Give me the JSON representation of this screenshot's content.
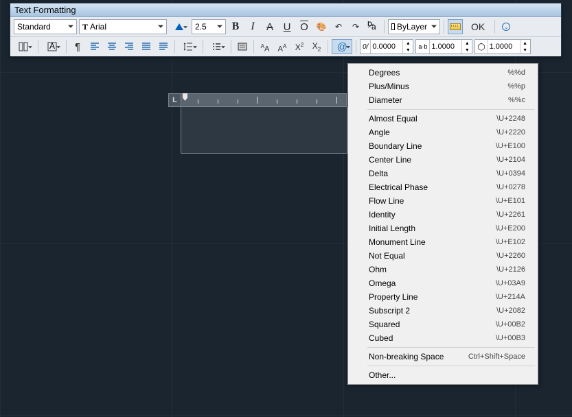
{
  "panel": {
    "title": "Text Formatting"
  },
  "row1": {
    "style": "Standard",
    "font": "Arial",
    "size": "2.5",
    "bold": "B",
    "italic": "I",
    "underlineA": "A",
    "underline": "U",
    "overline": "O",
    "layer": "ByLayer",
    "ok": "OK"
  },
  "row2": {
    "symbol": "@",
    "oblique_lbl": "0/",
    "oblique_val": "0.0000",
    "track_lbl": "a·b",
    "track_val": "1.0000",
    "width_val": "1.0000",
    "aA": "ªA",
    "Aa": "Aª"
  },
  "menu": {
    "g1": [
      {
        "l": "Degrees",
        "r": "%%d"
      },
      {
        "l": "Plus/Minus",
        "r": "%%p"
      },
      {
        "l": "Diameter",
        "r": "%%c"
      }
    ],
    "g2": [
      {
        "l": "Almost Equal",
        "r": "\\U+2248"
      },
      {
        "l": "Angle",
        "r": "\\U+2220"
      },
      {
        "l": "Boundary Line",
        "r": "\\U+E100"
      },
      {
        "l": "Center Line",
        "r": "\\U+2104"
      },
      {
        "l": "Delta",
        "r": "\\U+0394"
      },
      {
        "l": "Electrical Phase",
        "r": "\\U+0278"
      },
      {
        "l": "Flow Line",
        "r": "\\U+E101"
      },
      {
        "l": "Identity",
        "r": "\\U+2261"
      },
      {
        "l": "Initial Length",
        "r": "\\U+E200"
      },
      {
        "l": "Monument Line",
        "r": "\\U+E102"
      },
      {
        "l": "Not Equal",
        "r": "\\U+2260"
      },
      {
        "l": "Ohm",
        "r": "\\U+2126"
      },
      {
        "l": "Omega",
        "r": "\\U+03A9"
      },
      {
        "l": "Property Line",
        "r": "\\U+214A"
      },
      {
        "l": "Subscript 2",
        "r": "\\U+2082"
      },
      {
        "l": "Squared",
        "r": "\\U+00B2"
      },
      {
        "l": "Cubed",
        "r": "\\U+00B3"
      }
    ],
    "g3": [
      {
        "l": "Non-breaking Space",
        "r": "Ctrl+Shift+Space"
      }
    ],
    "g4": [
      {
        "l": "Other...",
        "r": ""
      }
    ]
  }
}
